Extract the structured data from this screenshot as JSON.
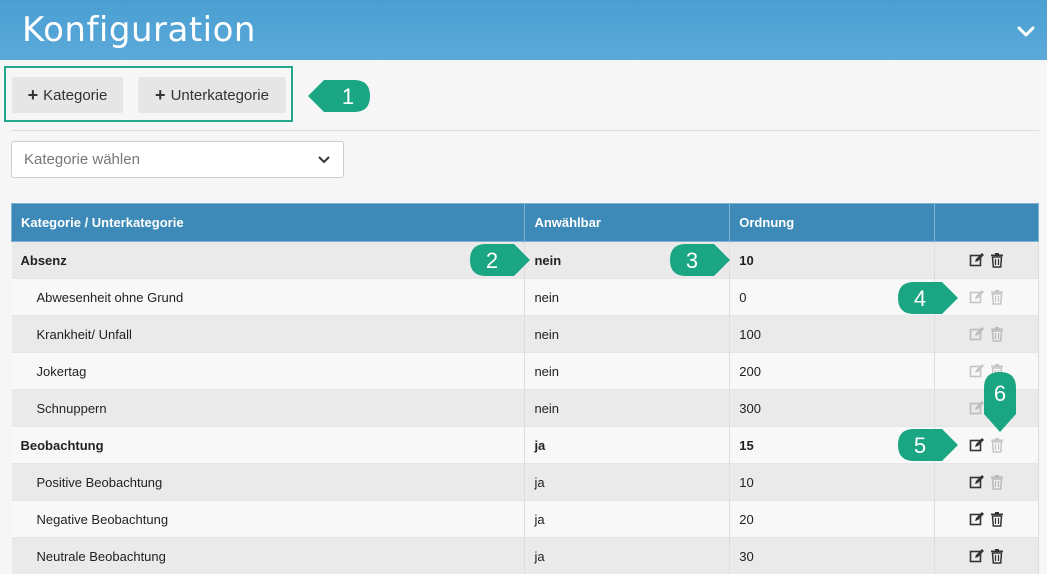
{
  "header": {
    "title": "Konfiguration"
  },
  "toolbar": {
    "add_category_label": "Kategorie",
    "add_subcategory_label": "Unterkategorie"
  },
  "select": {
    "placeholder": "Kategorie wählen"
  },
  "table": {
    "columns": [
      "Kategorie / Unterkategorie",
      "Anwählbar",
      "Ordnung",
      ""
    ],
    "rows": [
      {
        "name": "Absenz",
        "selectable": "nein",
        "order": "10",
        "category": true
      },
      {
        "name": "Abwesenheit ohne Grund",
        "selectable": "nein",
        "order": "0",
        "category": false
      },
      {
        "name": "Krankheit/ Unfall",
        "selectable": "nein",
        "order": "100",
        "category": false
      },
      {
        "name": "Jokertag",
        "selectable": "nein",
        "order": "200",
        "category": false
      },
      {
        "name": "Schnuppern",
        "selectable": "nein",
        "order": "300",
        "category": false
      },
      {
        "name": "Beobachtung",
        "selectable": "ja",
        "order": "15",
        "category": true
      },
      {
        "name": "Positive Beobachtung",
        "selectable": "ja",
        "order": "10",
        "category": false
      },
      {
        "name": "Negative Beobachtung",
        "selectable": "ja",
        "order": "20",
        "category": false
      },
      {
        "name": "Neutrale Beobachtung",
        "selectable": "ja",
        "order": "30",
        "category": false
      }
    ]
  },
  "callouts": [
    "1",
    "2",
    "3",
    "4",
    "5",
    "6"
  ],
  "colors": {
    "header": "#4a9fd2",
    "table_header": "#3d8ab8",
    "callout": "#1aa583"
  }
}
